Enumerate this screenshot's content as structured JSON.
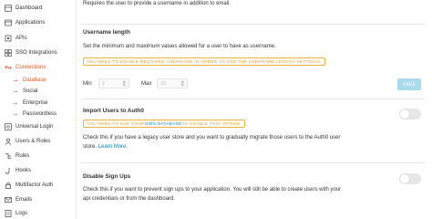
{
  "sidebar": {
    "items": [
      {
        "label": "Dashboard",
        "icon": "dashboard-icon"
      },
      {
        "label": "Applications",
        "icon": "applications-icon"
      },
      {
        "label": "APIs",
        "icon": "apis-icon"
      },
      {
        "label": "SSO Integrations",
        "icon": "sso-icon"
      },
      {
        "label": "Connections",
        "icon": "connections-icon",
        "active": true
      },
      {
        "label": "Universal Login",
        "icon": "universal-login-icon"
      },
      {
        "label": "Users & Roles",
        "icon": "users-icon"
      },
      {
        "label": "Rules",
        "icon": "rules-icon"
      },
      {
        "label": "Hooks",
        "icon": "hooks-icon"
      },
      {
        "label": "Multifactor Auth",
        "icon": "mfa-icon"
      },
      {
        "label": "Emails",
        "icon": "emails-icon"
      },
      {
        "label": "Logs",
        "icon": "logs-icon"
      }
    ],
    "subitems": [
      {
        "label": "Database",
        "active": true
      },
      {
        "label": "Social"
      },
      {
        "label": "Enterprise"
      },
      {
        "label": "Passwordless"
      }
    ],
    "accent_color": "#eb5424"
  },
  "main": {
    "intro_text": "Requires the user to provide a username in addition to email.",
    "username_length": {
      "title": "Username length",
      "description": "Set the minimum and maximum values allowed for a user to have as username.",
      "warning": "YOU NEED TO ENABLE REQUIRED USERNAME IN ORDER TO USE THE USERNAME LENGTH SETTINGS.",
      "min_label": "Min",
      "min_value": "1",
      "max_label": "Max",
      "max_value": "15",
      "save_label": "SAVE"
    },
    "import_users": {
      "title": "Import Users to Auth0",
      "warning_prefix": "YOU NEED TO USE YOUR ",
      "warning_link": "OWN DATABASE",
      "warning_suffix": " TO ENABLE THIS OPTION.",
      "description_line1": "Check this if you have a legacy user store and you want to gradually migrate those users to the Auth0 user",
      "description_line2_prefix": "store. ",
      "learn_more": "Learn More.",
      "enabled": false
    },
    "disable_signups": {
      "title": "Disable Sign Ups",
      "description_line1": "Check this if you want to prevent sign ups to your application. You will still be able to create users with your",
      "description_line2": "api credentials or from the dashboard.",
      "enabled": false
    }
  }
}
